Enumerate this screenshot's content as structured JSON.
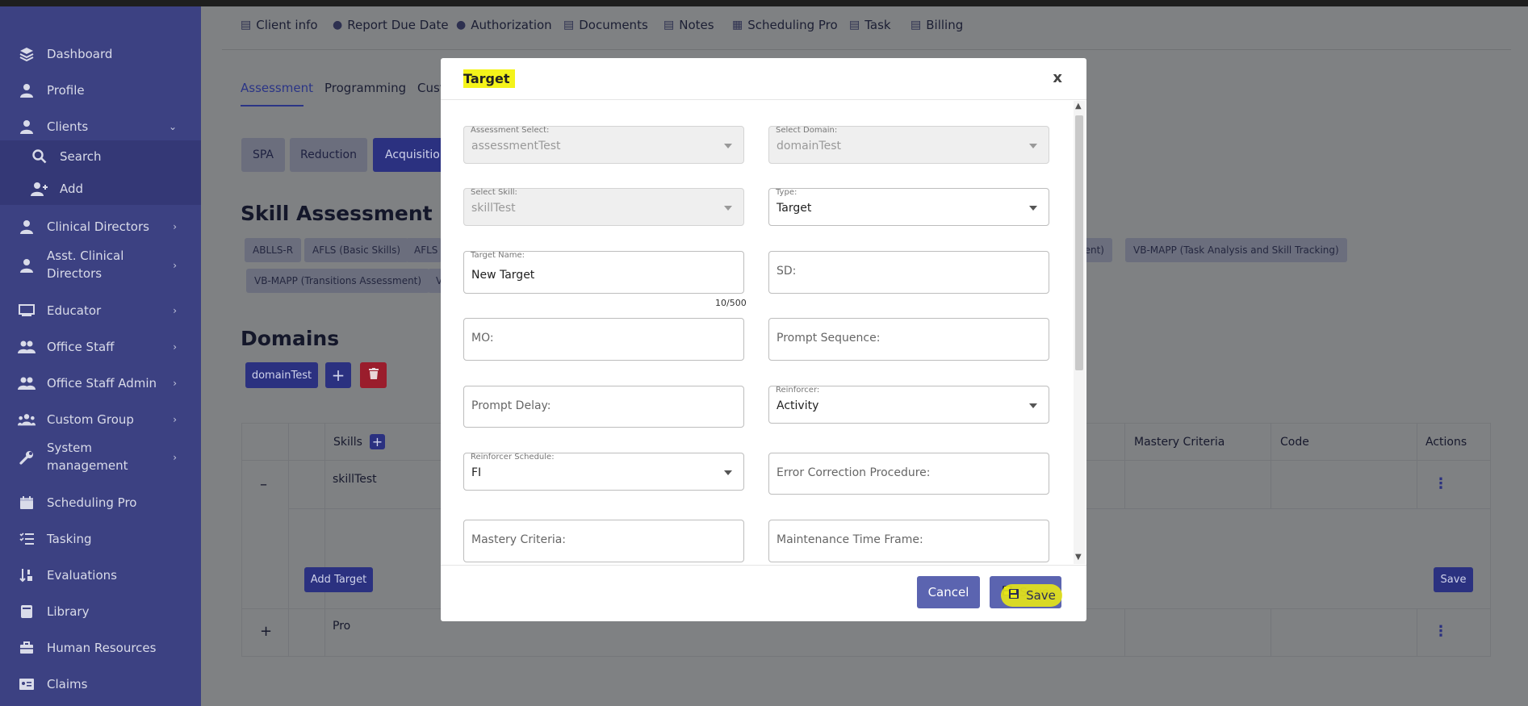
{
  "sidebar": {
    "items": [
      {
        "label": "Dashboard",
        "icon": "layers-icon"
      },
      {
        "label": "Profile",
        "icon": "user-icon"
      },
      {
        "label": "Clients",
        "icon": "user-icon"
      },
      {
        "label": "Search",
        "icon": "search-icon"
      },
      {
        "label": "Add",
        "icon": "user-plus-icon"
      },
      {
        "label": "Clinical Directors",
        "icon": "user-tie-icon"
      },
      {
        "label": "Asst. Clinical",
        "label2": "Directors",
        "icon": "user-tie-icon"
      },
      {
        "label": "Educator",
        "icon": "chalkboard-icon"
      },
      {
        "label": "Office Staff",
        "icon": "users-icon"
      },
      {
        "label": "Office Staff Admin",
        "icon": "users-icon"
      },
      {
        "label": "Custom Group",
        "icon": "group-icon"
      },
      {
        "label": "System",
        "label2": "management",
        "icon": "wrench-icon"
      },
      {
        "label": "Scheduling Pro",
        "icon": "calendar-icon"
      },
      {
        "label": "Tasking",
        "icon": "tasks-icon"
      },
      {
        "label": "Evaluations",
        "icon": "sort-icon"
      },
      {
        "label": "Library",
        "icon": "book-icon"
      },
      {
        "label": "Human Resources",
        "icon": "briefcase-icon"
      },
      {
        "label": "Claims",
        "icon": "id-card-icon"
      }
    ]
  },
  "top_tabs": [
    {
      "label": "Client info",
      "icon": "chart-icon"
    },
    {
      "label": "Report Due Date",
      "icon": "user-icon"
    },
    {
      "label": "Authorization",
      "icon": "user-icon"
    },
    {
      "label": "Documents",
      "icon": "chart-icon"
    },
    {
      "label": "Notes",
      "icon": "chart-icon"
    },
    {
      "label": "Scheduling Pro",
      "icon": "calendar-icon"
    },
    {
      "label": "Task",
      "icon": "list-icon"
    },
    {
      "label": "Billing",
      "icon": "chart-icon"
    }
  ],
  "sub_tabs": [
    "Assessment",
    "Programming",
    "Cust"
  ],
  "pills": [
    "SPA",
    "Reduction",
    "Acquisition"
  ],
  "skill_assessment": {
    "title": "Skill Assessment",
    "chips_row1": [
      "ABLLS-R",
      "AFLS (Basic Skills)",
      "AFLS (",
      "ment)",
      "VB-MAPP (Task Analysis and Skill Tracking)"
    ],
    "chips_row2": [
      "VB-MAPP (Transitions Assessment)",
      "V"
    ]
  },
  "domains": {
    "title": "Domains",
    "domain_button": "domainTest",
    "add_symbol": "+",
    "delete_icon": "trash-icon"
  },
  "table": {
    "headers": {
      "skills": "Skills",
      "mastery": "Mastery Criteria",
      "code": "Code",
      "actions": "Actions"
    },
    "rows": [
      {
        "toggle": "–",
        "skill": "skillTest"
      },
      {
        "toggle": "+",
        "skill": "Pro"
      }
    ],
    "add_target": "Add Target",
    "save": "Save",
    "kebab": "⋮"
  },
  "modal": {
    "title": "Target",
    "close": "x",
    "fields": {
      "assessment_label": "Assessment Select:",
      "assessment_value": "assessmentTest",
      "domain_label": "Select Domain:",
      "domain_value": "domainTest",
      "skill_label": "Select Skill:",
      "skill_value": "skillTest",
      "type_label": "Type:",
      "type_value": "Target",
      "target_name_label": "Target Name:",
      "target_name_value": "New Target",
      "target_name_counter": "10/500",
      "sd_placeholder": "SD:",
      "mo_placeholder": "MO:",
      "prompt_sequence_placeholder": "Prompt Sequence:",
      "prompt_delay_placeholder": "Prompt Delay:",
      "reinforcer_label": "Reinforcer:",
      "reinforcer_value": "Activity",
      "reinforcer_schedule_label": "Reinforcer Schedule:",
      "reinforcer_schedule_value": "FI",
      "error_correction_placeholder": "Error Correction Procedure:",
      "mastery_criteria_placeholder": "Mastery Criteria:",
      "maintenance_placeholder": "Maintenance Time Frame:"
    },
    "cancel": "Cancel",
    "save": "Save"
  },
  "colors": {
    "sidebar": "#3c4182",
    "accent": "#5b64b0",
    "highlight": "#f4f31a",
    "danger": "#9a1d2c"
  }
}
